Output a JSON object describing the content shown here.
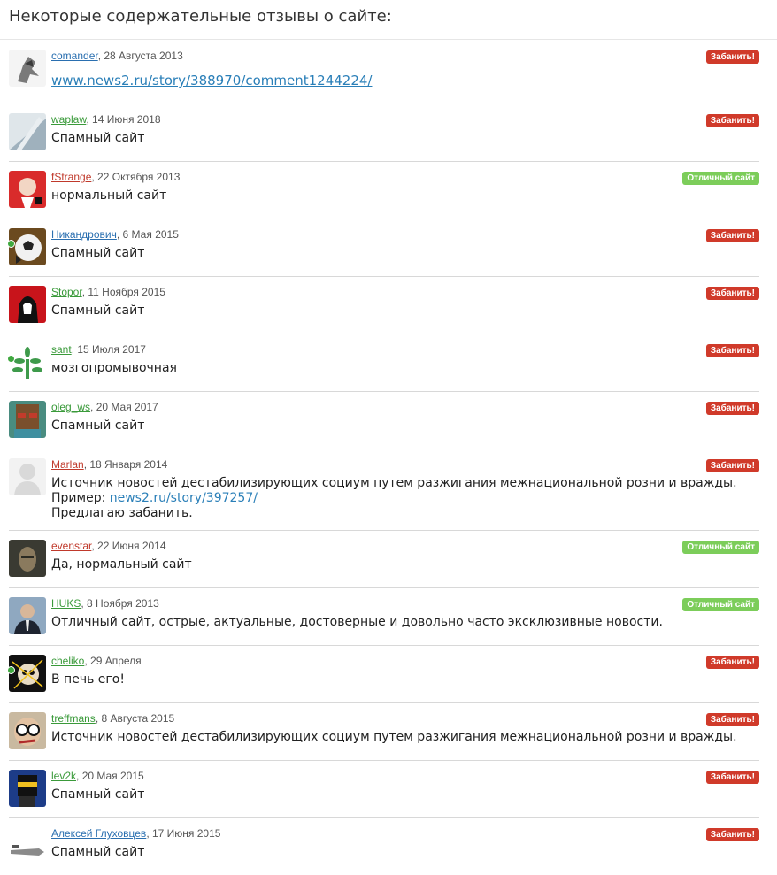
{
  "page": {
    "title": "Некоторые содержательные отзывы о сайте:"
  },
  "comments": [
    {
      "user": "comander",
      "date": "28 Августа 2013",
      "link": "www.news2.ru/story/388970/comment1244224/",
      "badge": "Забанить!"
    },
    {
      "user": "waplaw",
      "date": "14 Июня 2018",
      "text": "Спамный сайт",
      "badge": "Забанить!"
    },
    {
      "user": "fStrange",
      "date": "22 Октября 2013",
      "text": "нормальный сайт",
      "badge": "Отличный сайт"
    },
    {
      "user": "Никандрович",
      "date": "6 Мая 2015",
      "text": "Спамный сайт",
      "badge": "Забанить!"
    },
    {
      "user": "Stopor",
      "date": "11 Ноября 2015",
      "text": "Спамный сайт",
      "badge": "Забанить!"
    },
    {
      "user": "sant",
      "date": "15 Июля 2017",
      "text": "мозгопромывочная",
      "badge": "Забанить!"
    },
    {
      "user": "oleg_ws",
      "date": "20 Мая 2017",
      "text": "Спамный сайт",
      "badge": "Забанить!"
    },
    {
      "user": "Marlan",
      "date": "18 Января 2014",
      "line1": "Источник новостей дестабилизирующих социум путем разжигания межнациональной розни и вражды.",
      "line2_prefix": "Пример: ",
      "line2_link": "news2.ru/story/397257/",
      "line3": "Предлагаю забанить.",
      "badge": "Забанить!"
    },
    {
      "user": "evenstar",
      "date": "22 Июня 2014",
      "text": "Да, нормальный сайт",
      "badge": "Отличный сайт"
    },
    {
      "user": "HUKS",
      "date": "8 Ноября 2013",
      "text": "Отличный сайт, острые, актуальные, достоверные и довольно часто эксклюзивные новости.",
      "badge": "Отличный сайт"
    },
    {
      "user": "cheliko",
      "date": "29 Апреля",
      "text": "В печь его!",
      "badge": "Забанить!"
    },
    {
      "user": "treffmans",
      "date": "8 Августа 2015",
      "text": "Источник новостей дестабилизирующих социум путем разжигания межнациональной розни и вражды.",
      "badge": "Забанить!"
    },
    {
      "user": "lev2k",
      "date": "20 Мая 2015",
      "text": "Спамный сайт",
      "badge": "Забанить!"
    },
    {
      "user": "Алексей Глуховцев",
      "date": "17 Июня 2015",
      "text": "Спамный сайт",
      "badge": "Забанить!"
    }
  ],
  "colors": {
    "ban_badge": "#d03a2a",
    "good_badge": "#7ccd5a",
    "link": "#2a7fb8",
    "online_dot": "#3fa83f"
  }
}
